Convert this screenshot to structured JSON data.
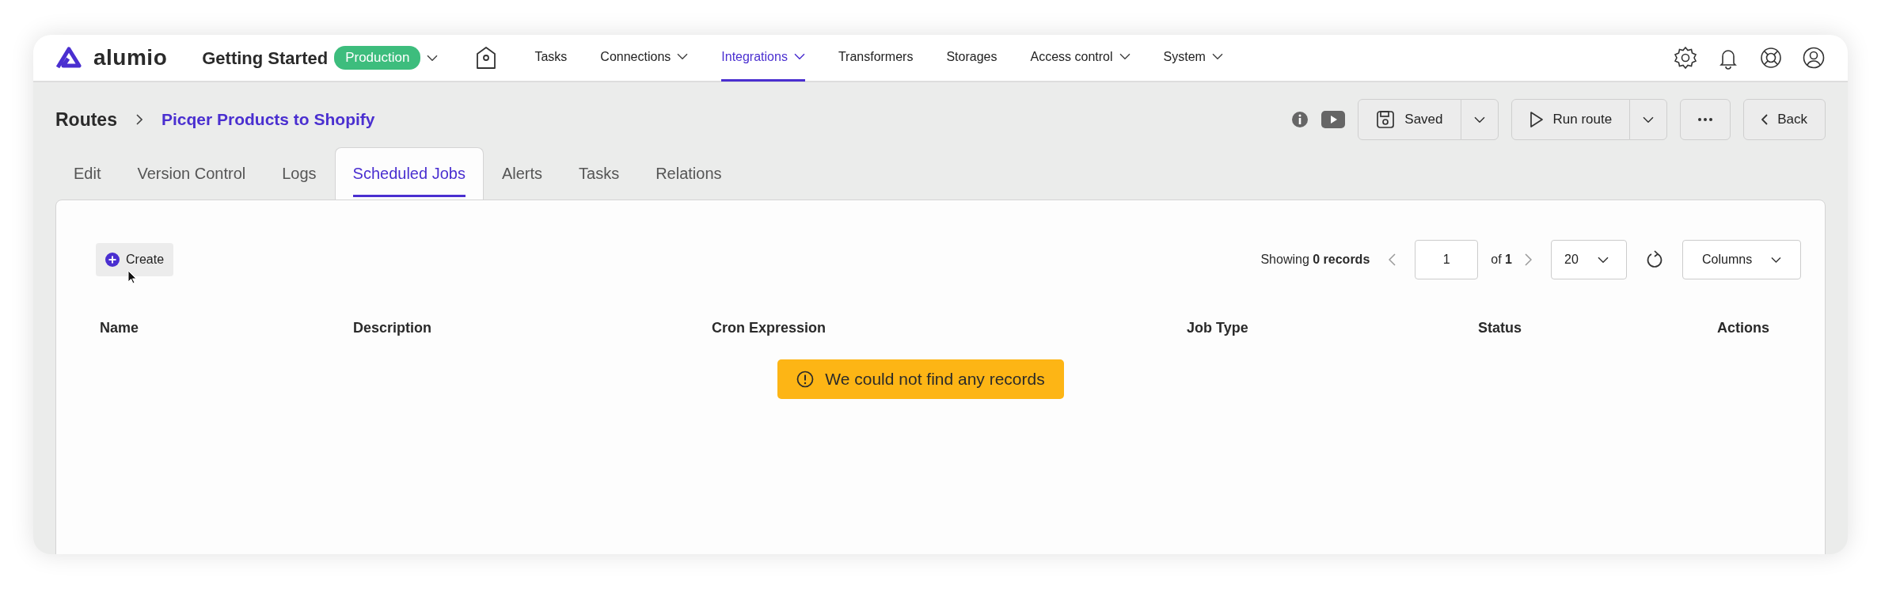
{
  "logo": {
    "text": "alumio"
  },
  "environment": {
    "name": "Getting Started",
    "badge": "Production"
  },
  "nav": [
    {
      "label": "Tasks",
      "selected": false,
      "dropdown": false
    },
    {
      "label": "Connections",
      "selected": false,
      "dropdown": true
    },
    {
      "label": "Integrations",
      "selected": true,
      "dropdown": true
    },
    {
      "label": "Transformers",
      "selected": false,
      "dropdown": false
    },
    {
      "label": "Storages",
      "selected": false,
      "dropdown": false
    },
    {
      "label": "Access control",
      "selected": false,
      "dropdown": true
    },
    {
      "label": "System",
      "selected": false,
      "dropdown": true
    }
  ],
  "breadcrumb": {
    "root": "Routes",
    "current": "Picqer Products to Shopify"
  },
  "actions": {
    "saved": "Saved",
    "run": "Run route",
    "back": "Back"
  },
  "tabs": [
    {
      "label": "Edit",
      "selected": false
    },
    {
      "label": "Version Control",
      "selected": false
    },
    {
      "label": "Logs",
      "selected": false
    },
    {
      "label": "Scheduled Jobs",
      "selected": true
    },
    {
      "label": "Alerts",
      "selected": false
    },
    {
      "label": "Tasks",
      "selected": false
    },
    {
      "label": "Relations",
      "selected": false
    }
  ],
  "toolbar": {
    "create": "Create",
    "showing": "Showing **0 records**",
    "page": "1",
    "of": "of **1**",
    "per_page": "20",
    "columns": "Columns"
  },
  "table": {
    "columns": [
      "Name",
      "Description",
      "Cron Expression",
      "Job Type",
      "Status",
      "Actions"
    ]
  },
  "empty_message": "We could not find any records"
}
